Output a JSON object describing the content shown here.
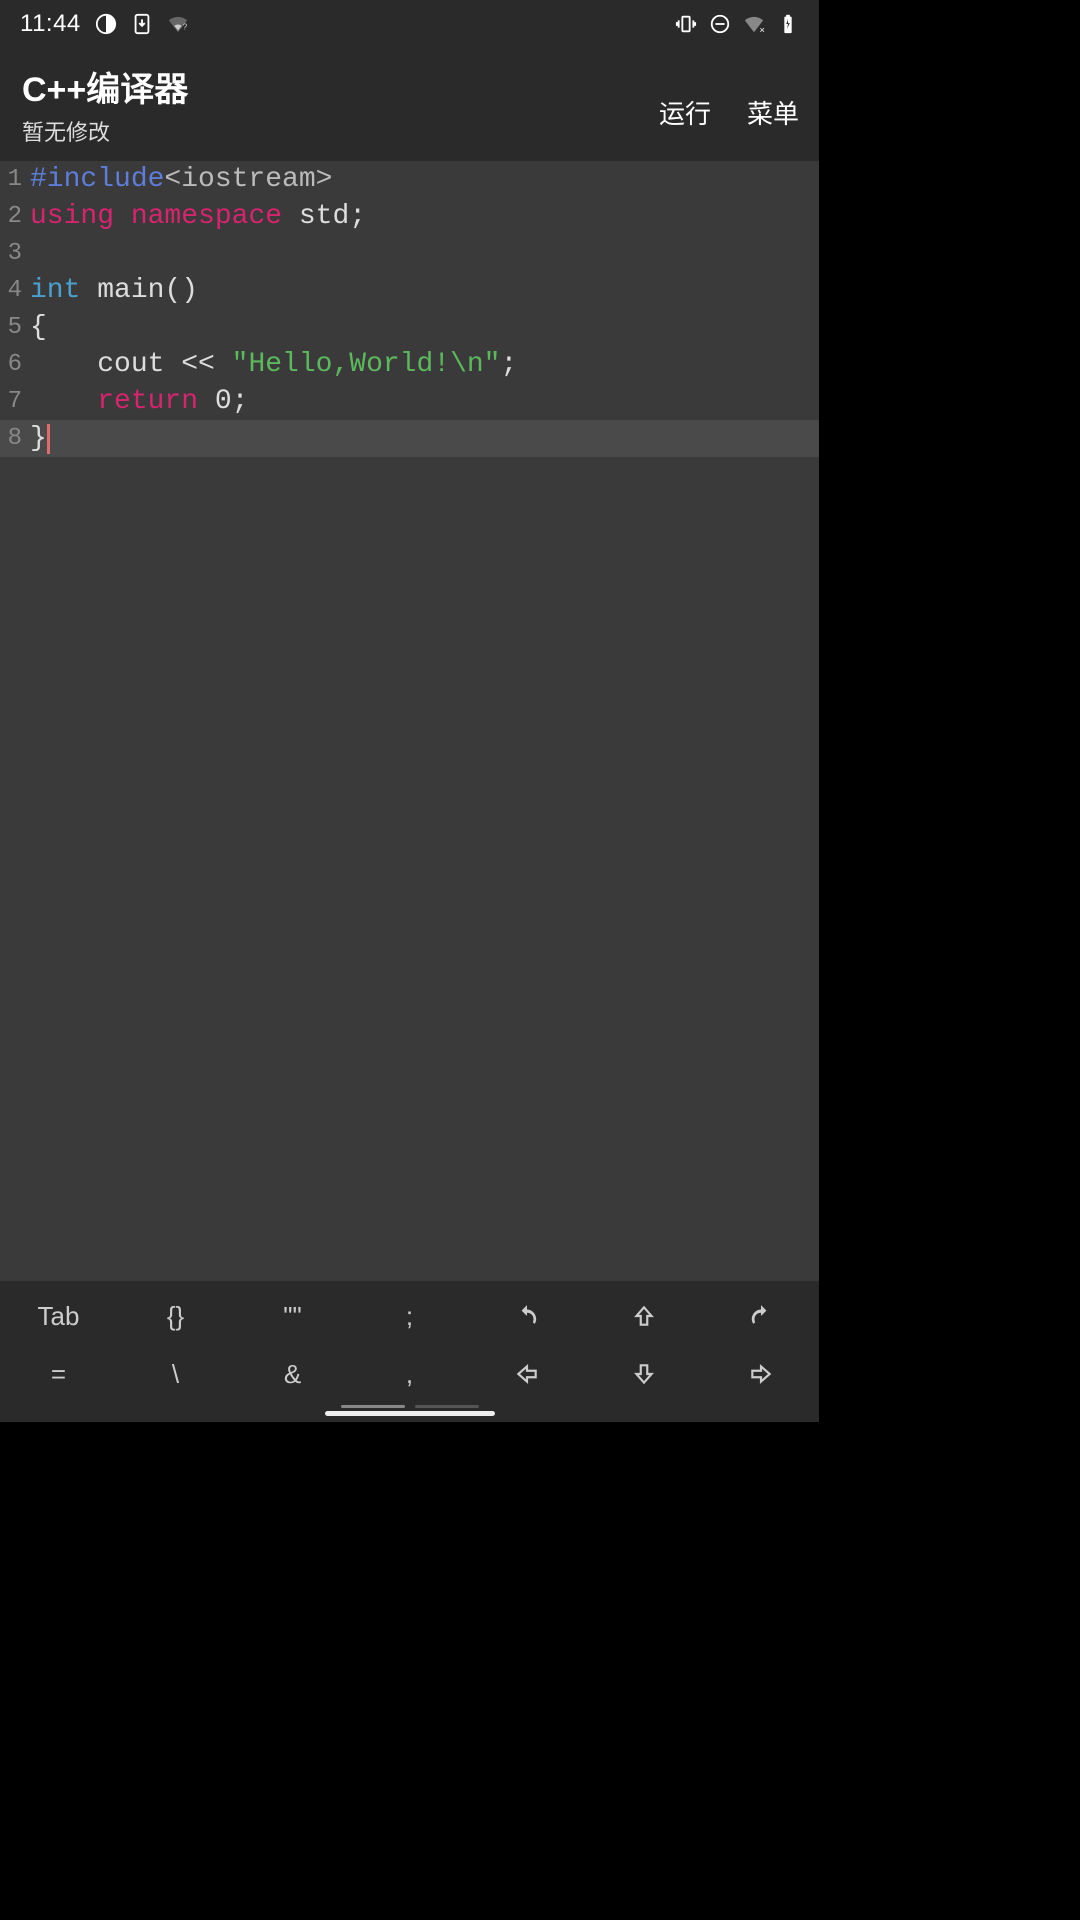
{
  "status": {
    "time": "11:44"
  },
  "header": {
    "title": "C++编译器",
    "subtitle": "暂无修改",
    "run": "运行",
    "menu": "菜单"
  },
  "code": {
    "lines": [
      {
        "n": "1",
        "segments": [
          {
            "cls": "tok-preproc",
            "t": "#include"
          },
          {
            "cls": "tok-include-text",
            "t": "<iostream>"
          }
        ]
      },
      {
        "n": "2",
        "segments": [
          {
            "cls": "tok-keyword",
            "t": "using "
          },
          {
            "cls": "tok-keyword",
            "t": "namespace "
          },
          {
            "cls": "tok-plain",
            "t": "std;"
          }
        ]
      },
      {
        "n": "3",
        "segments": []
      },
      {
        "n": "4",
        "segments": [
          {
            "cls": "tok-type",
            "t": "int "
          },
          {
            "cls": "tok-plain",
            "t": "main()"
          }
        ]
      },
      {
        "n": "5",
        "segments": [
          {
            "cls": "tok-plain",
            "t": "{"
          }
        ]
      },
      {
        "n": "6",
        "segments": [
          {
            "cls": "tok-plain",
            "t": "    cout << "
          },
          {
            "cls": "tok-string",
            "t": "\"Hello,World!\\n\""
          },
          {
            "cls": "tok-plain",
            "t": ";"
          }
        ]
      },
      {
        "n": "7",
        "segments": [
          {
            "cls": "tok-plain",
            "t": "    "
          },
          {
            "cls": "tok-keyword",
            "t": "return "
          },
          {
            "cls": "tok-plain",
            "t": "0;"
          }
        ]
      },
      {
        "n": "8",
        "current": true,
        "cursorAfter": true,
        "segments": [
          {
            "cls": "tok-plain",
            "t": "}"
          }
        ]
      }
    ]
  },
  "toolbar": {
    "row1": [
      "Tab",
      "{}",
      "\"\"",
      ";",
      "undo-icon",
      "arrow-up-icon",
      "redo-icon"
    ],
    "row2": [
      "=",
      "\\",
      "&",
      ",",
      "arrow-left-icon",
      "arrow-down-icon",
      "arrow-right-icon"
    ]
  }
}
